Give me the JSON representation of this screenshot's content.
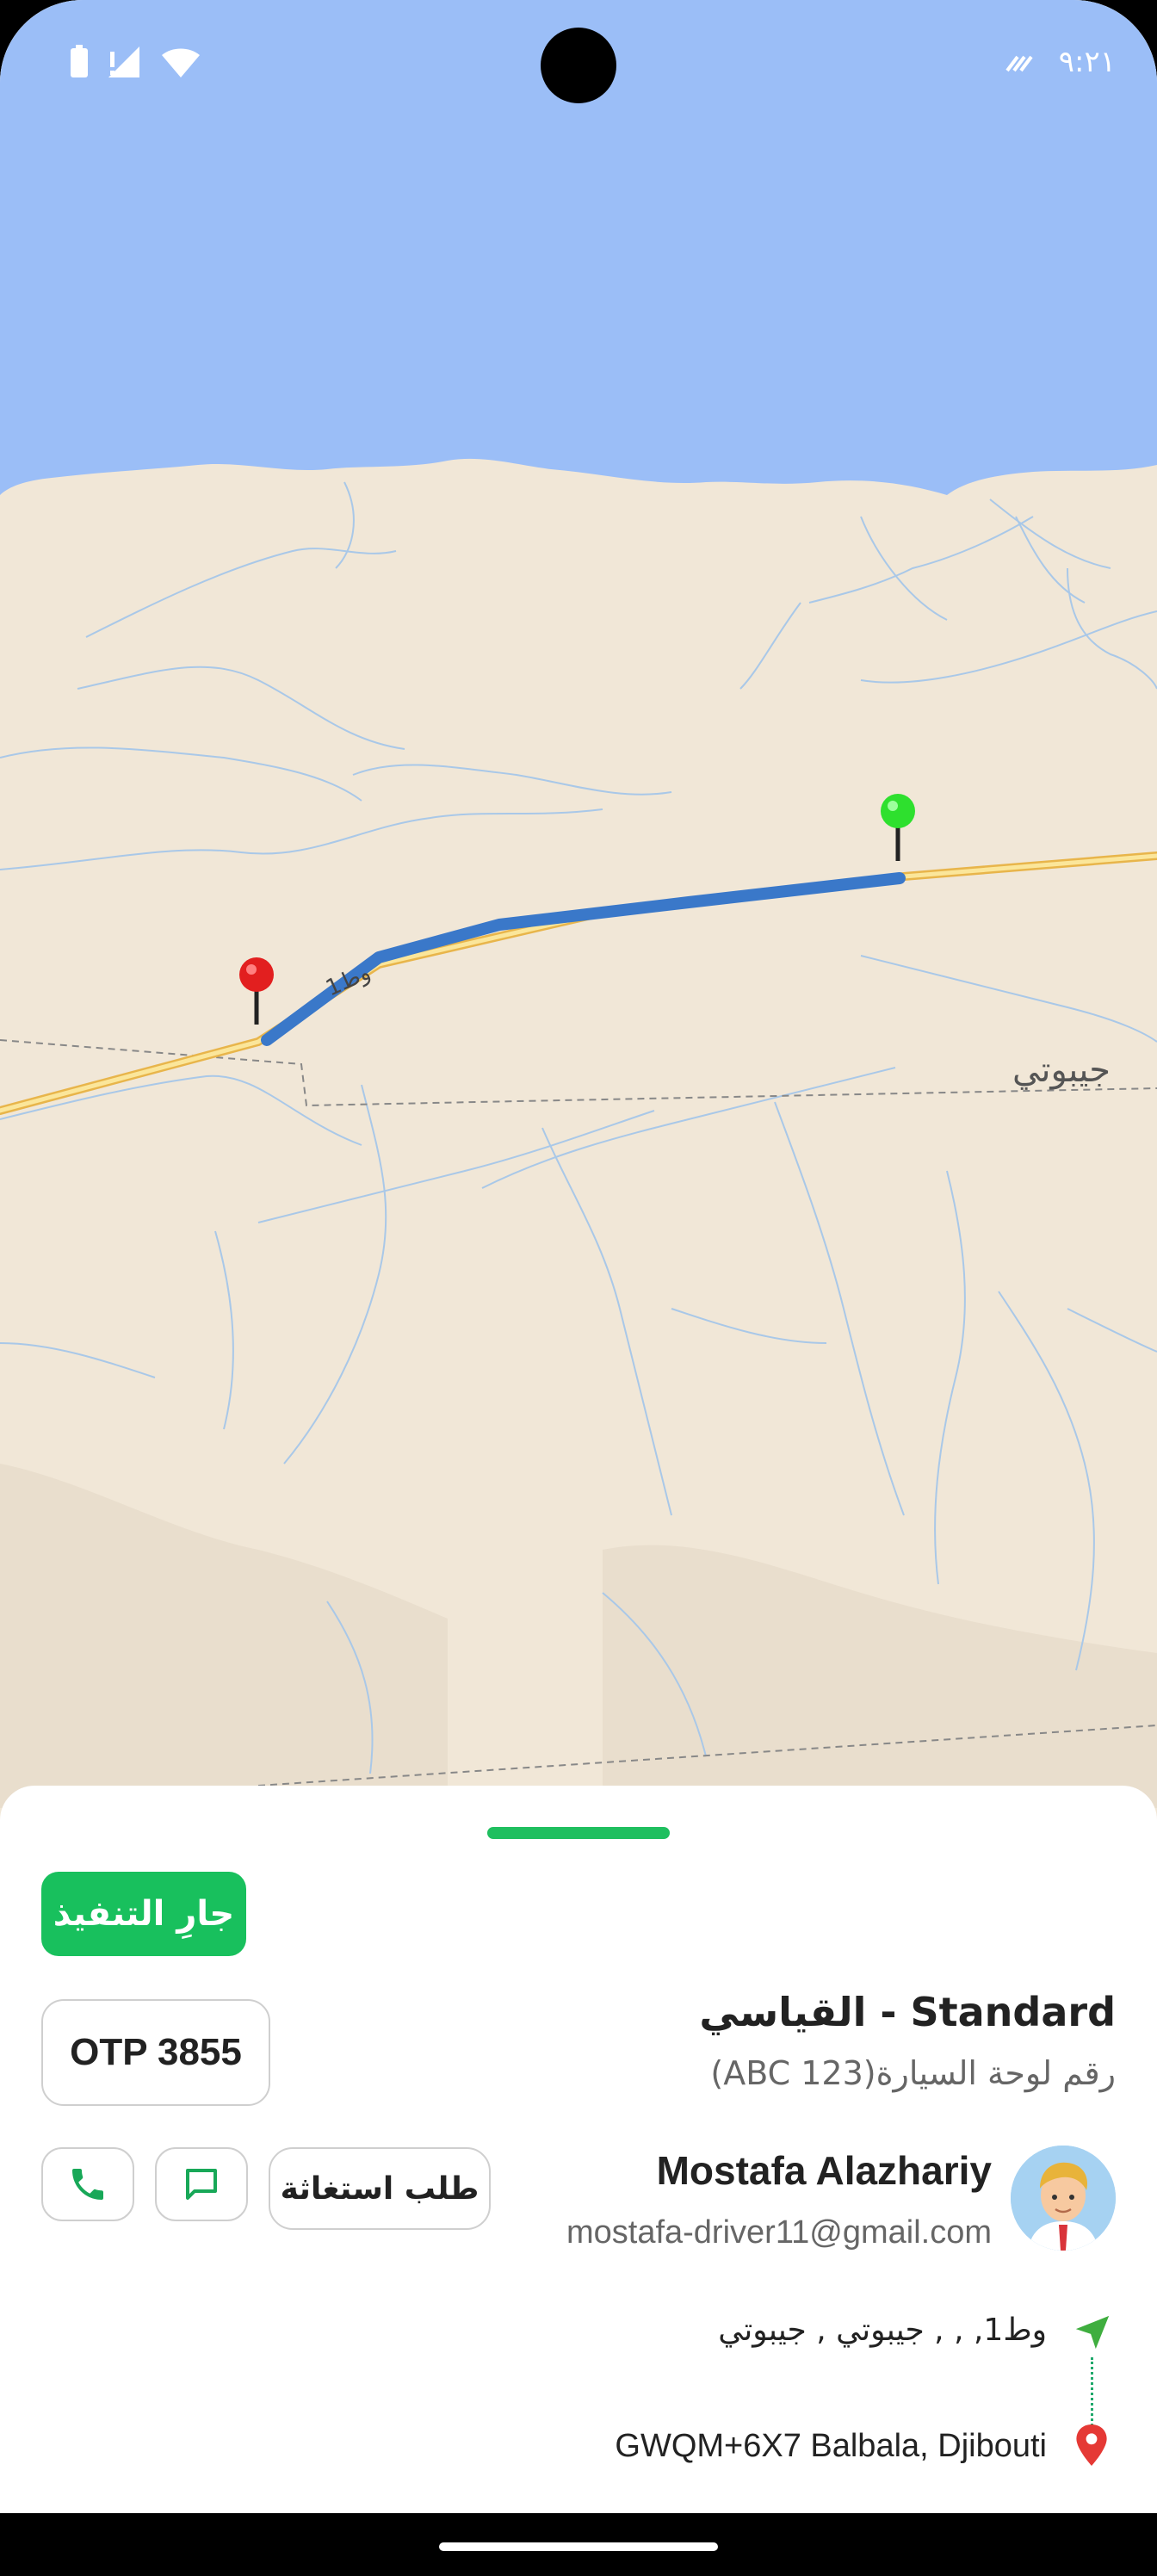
{
  "status_bar": {
    "time": "٩:٢١"
  },
  "map": {
    "country_label": "جيبوتي",
    "road_label": "وط1"
  },
  "ride": {
    "status_badge": "جارِ التنفيذ",
    "otp": "OTP 3855",
    "service_title": "Standard - القياسي",
    "plate": "رقم لوحة السيارة(ABC 123)",
    "sos_label": "طلب استغاثة",
    "driver_name": "Mostafa Alazhariy",
    "driver_email": "mostafa-driver11@gmail.com",
    "pickup_address": "وط1, , , جيبوتي , جيبوتي",
    "dropoff_address": "GWQM+6X7 Balbala, Djibouti"
  },
  "colors": {
    "accent_green": "#18c05d",
    "route_blue": "#3a78c9",
    "sea_blue": "#9bbef7",
    "land": "#f1e7d7"
  },
  "icons": {
    "call": "phone-icon",
    "message": "chat-icon",
    "pickup": "navigation-arrow-icon",
    "dropoff": "location-pin-icon",
    "start_pin": "green-pin-icon",
    "end_pin": "red-pin-icon"
  }
}
